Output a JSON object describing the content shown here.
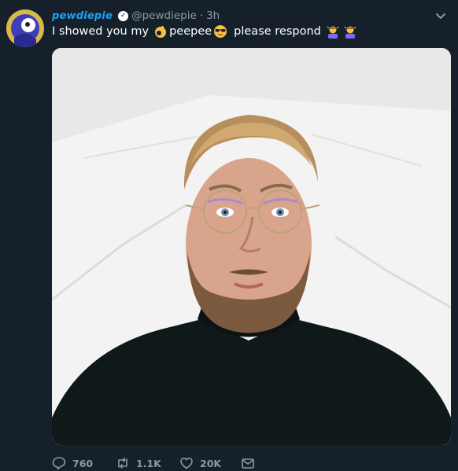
{
  "tweet": {
    "display_name": "pewdiepie",
    "handle": "@pewdiepie",
    "separator": "·",
    "time": "3h",
    "text_parts": [
      "I showed you my",
      "peepee",
      "please respond"
    ]
  },
  "icons": {
    "avatar": "avatar-icon",
    "verified": "verified-badge-icon",
    "chevron": "chevron-down-icon",
    "ok_hand": "ok-hand-emoji",
    "sunglasses": "sunglasses-face-emoji",
    "pray": "person-bowing-emoji",
    "reply": "reply-icon",
    "retweet": "retweet-icon",
    "like": "heart-icon",
    "dm": "mail-icon"
  },
  "actions": {
    "reply_count": "760",
    "retweet_count": "1.1K",
    "like_count": "20K"
  },
  "colors": {
    "background": "#15202b",
    "accent": "#1da1f2",
    "secondary_text": "#8899a6"
  }
}
